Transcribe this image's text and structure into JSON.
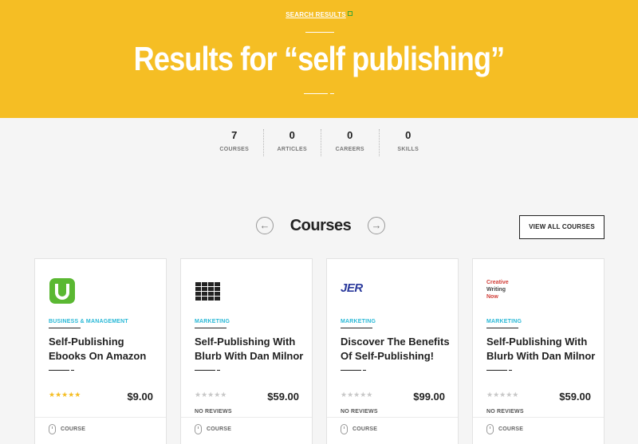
{
  "hero": {
    "breadcrumb": "SEARCH RESULTS",
    "title": "Results for “self publishing”"
  },
  "stats": [
    {
      "count": "7",
      "label": "COURSES"
    },
    {
      "count": "0",
      "label": "ARTICLES"
    },
    {
      "count": "0",
      "label": "CAREERS"
    },
    {
      "count": "0",
      "label": "SKILLS"
    }
  ],
  "section": {
    "title": "Courses",
    "view_all": "VIEW ALL COURSES"
  },
  "courses": [
    {
      "logo": "udemy-logo",
      "category": "BUSINESS & MANAGEMENT",
      "title": "Self-Publishing Ebooks On Amazon",
      "stars": "★★★★★",
      "rating": 5,
      "price": "$9.00",
      "reviews": "",
      "type": "COURSE"
    },
    {
      "logo": "grid-logo",
      "category": "MARKETING",
      "title": "Self-Publishing With Blurb With Dan Milnor",
      "stars": "★★★★★",
      "rating": 0,
      "price": "$59.00",
      "reviews": "NO REVIEWS",
      "type": "COURSE"
    },
    {
      "logo": "jer-logo",
      "logo_text": "JER",
      "category": "MARKETING",
      "title": "Discover The Benefits Of Self-Publishing!",
      "stars": "★★★★★",
      "rating": 0,
      "price": "$99.00",
      "reviews": "NO REVIEWS",
      "type": "COURSE"
    },
    {
      "logo": "creative-writing-now-logo",
      "logo_lines": [
        "Creative",
        "Writing",
        "Now"
      ],
      "category": "MARKETING",
      "title": "Self-Publishing With Blurb With Dan Milnor",
      "stars": "★★★★★",
      "rating": 0,
      "price": "$59.00",
      "reviews": "NO REVIEWS",
      "type": "COURSE"
    }
  ],
  "colors": {
    "hero_bg": "#f5be24",
    "category": "#29b8d6",
    "star_gold": "#f5be24",
    "udemy_green": "#5ab832"
  }
}
